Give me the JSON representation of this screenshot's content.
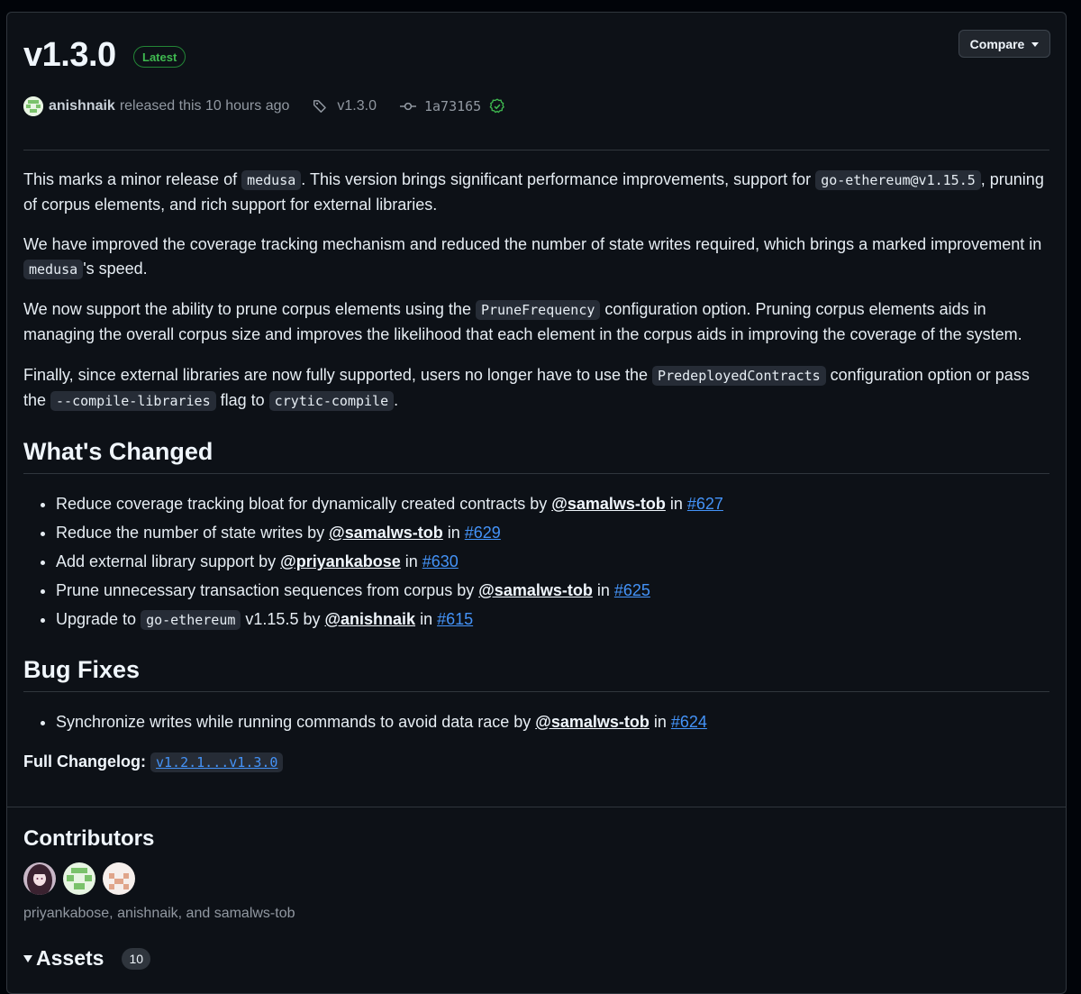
{
  "release": {
    "title": "v1.3.0",
    "latest_badge": "Latest",
    "compare_label": "Compare",
    "author": "anishnaik",
    "released_text": "released this 10 hours ago",
    "tag": "v1.3.0",
    "commit": "1a73165"
  },
  "body": {
    "p1": {
      "a": "This marks a minor release of ",
      "code1": "medusa",
      "b": ". This version brings significant performance improvements, support for ",
      "code2": "go-ethereum@v1.15.5",
      "c": ", pruning of corpus elements, and rich support for external libraries."
    },
    "p2": {
      "a": "We have improved the coverage tracking mechanism and reduced the number of state writes required, which brings a marked improvement in ",
      "code1": "medusa",
      "b": "'s speed."
    },
    "p3": {
      "a": "We now support the ability to prune corpus elements using the ",
      "code1": "PruneFrequency",
      "b": " configuration option. Pruning corpus elements aids in managing the overall corpus size and improves the likelihood that each element in the corpus aids in improving the coverage of the system."
    },
    "p4": {
      "a": "Finally, since external libraries are now fully supported, users no longer have to use the ",
      "code1": "PredeployedContracts",
      "b": " configuration option or pass the ",
      "code2": "--compile-libraries",
      "c": " flag to ",
      "code3": "crytic-compile",
      "d": "."
    }
  },
  "whats_changed": {
    "heading": "What's Changed",
    "items": [
      {
        "text": "Reduce coverage tracking bloat for dynamically created contracts by ",
        "user": "@samalws-tob",
        "in": " in ",
        "pr": "#627"
      },
      {
        "text": "Reduce the number of state writes by ",
        "user": "@samalws-tob",
        "in": " in ",
        "pr": "#629"
      },
      {
        "text": "Add external library support by ",
        "user": "@priyankabose",
        "in": " in ",
        "pr": "#630"
      },
      {
        "text": "Prune unnecessary transaction sequences from corpus by ",
        "user": "@samalws-tob",
        "in": " in ",
        "pr": "#625"
      },
      {
        "text_a": "Upgrade to ",
        "code": "go-ethereum",
        "text": " v1.15.5 by ",
        "user": "@anishnaik",
        "in": " in ",
        "pr": "#615"
      }
    ]
  },
  "bug_fixes": {
    "heading": "Bug Fixes",
    "items": [
      {
        "text": "Synchronize writes while running commands to avoid data race by ",
        "user": "@samalws-tob",
        "in": " in ",
        "pr": "#624"
      }
    ]
  },
  "changelog": {
    "label": "Full Changelog:",
    "link": "v1.2.1...v1.3.0"
  },
  "contributors": {
    "heading": "Contributors",
    "names": "priyankabose, anishnaik, and samalws-tob"
  },
  "assets": {
    "label": "Assets",
    "count": "10"
  },
  "colors": {
    "background": "#0d1117",
    "link": "#4493f8",
    "latest": "#3fb950",
    "border": "#30363d"
  }
}
